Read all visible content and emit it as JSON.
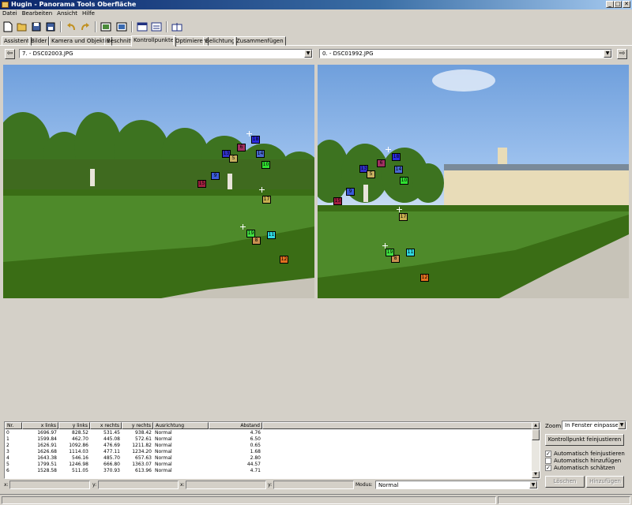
{
  "window": {
    "title": "Hugin - Panorama Tools Oberfläche",
    "minimize": "_",
    "maximize": "□",
    "close": "✕"
  },
  "menu": [
    "Datei",
    "Bearbeiten",
    "Ansicht",
    "Hilfe"
  ],
  "toolbar_icons": [
    "new-file-icon",
    "open-folder-icon",
    "save-icon",
    "save-as-icon",
    "undo-icon",
    "redo-icon",
    "add-image-icon",
    "add-time-series-icon",
    "preview-icon",
    "optimize-icon",
    "stitch-icon"
  ],
  "tabs": [
    "Assistent",
    "Bilder",
    "Kamera und Objektiv",
    "Beschnitt",
    "Kontrollpunkte",
    "Optimieren",
    "Belichtung",
    "Zusammenfügen"
  ],
  "active_tab": "Kontrollpunkte",
  "left_image": {
    "selected": "7. - DSC02003.JPG",
    "nav": "⇦"
  },
  "right_image": {
    "selected": "0. - DSC01992.JPG",
    "nav": "⇨"
  },
  "control_points_left": [
    {
      "label": "18",
      "color": "#2a2ae0"
    },
    {
      "label": "6",
      "color": "#a03060"
    },
    {
      "label": "13",
      "color": "#3030c8"
    },
    {
      "label": "14",
      "color": "#4a6ad0"
    },
    {
      "label": "10",
      "color": "#30e030"
    },
    {
      "label": "9",
      "color": "#3a5ad8"
    },
    {
      "label": "15",
      "color": "#a02040"
    },
    {
      "label": "17",
      "color": "#c8b050"
    },
    {
      "label": "8",
      "color": "#c89050"
    },
    {
      "label": "11",
      "color": "#30d8e0"
    },
    {
      "label": "12",
      "color": "#e07020"
    },
    {
      "label": "19",
      "color": "#40e040"
    },
    {
      "label": "5",
      "color": "#c8b060"
    }
  ],
  "control_points_right": [
    {
      "label": "18",
      "color": "#2a2ae0"
    },
    {
      "label": "6",
      "color": "#a03060"
    },
    {
      "label": "13",
      "color": "#3030c8"
    },
    {
      "label": "14",
      "color": "#4a6ad0"
    },
    {
      "label": "10",
      "color": "#30e030"
    },
    {
      "label": "9",
      "color": "#3a5ad8"
    },
    {
      "label": "15",
      "color": "#a02040"
    },
    {
      "label": "17",
      "color": "#c8b050"
    },
    {
      "label": "8",
      "color": "#c89050"
    },
    {
      "label": "11",
      "color": "#30d8e0"
    },
    {
      "label": "12",
      "color": "#e07020"
    },
    {
      "label": "19",
      "color": "#40e040"
    },
    {
      "label": "5",
      "color": "#c8b060"
    }
  ],
  "table": {
    "headers": [
      "Nr.",
      "x links",
      "y links",
      "x rechts",
      "y rechts",
      "Ausrichtung",
      "Abstand"
    ],
    "rows": [
      [
        "0",
        "1696.97",
        "828.52",
        "531.45",
        "938.42",
        "Normal",
        "4.76"
      ],
      [
        "1",
        "1599.84",
        "462.70",
        "445.08",
        "572.61",
        "Normal",
        "6.50"
      ],
      [
        "2",
        "1626.91",
        "1092.86",
        "476.69",
        "1211.82",
        "Normal",
        "0.65"
      ],
      [
        "3",
        "1626.68",
        "1114.03",
        "477.11",
        "1234.20",
        "Normal",
        "1.68"
      ],
      [
        "4",
        "1643.38",
        "546.16",
        "485.70",
        "657.63",
        "Normal",
        "2.80"
      ],
      [
        "5",
        "1799.51",
        "1246.98",
        "666.80",
        "1363.07",
        "Normal",
        "44.57"
      ],
      [
        "6",
        "1528.58",
        "511.05",
        "370.93",
        "613.96",
        "Normal",
        "4.71"
      ]
    ]
  },
  "coords": {
    "x1": "x:",
    "y1": "y:",
    "x2": "x:",
    "y2": "y:",
    "mode_label": "Modus:",
    "mode_value": "Normal"
  },
  "zoom": {
    "label": "Zoom:",
    "value": "In Fenster einpassen"
  },
  "fine_tune_button": "Kontrollpunkt feinjustieren",
  "checkboxes": [
    {
      "label": "Automatisch feinjustieren",
      "checked": true
    },
    {
      "label": "Automatisch hinzufügen",
      "checked": false
    },
    {
      "label": "Automatisch schätzen",
      "checked": true
    }
  ],
  "delete_button": "Löschen",
  "add_button": "Hinzufügen"
}
